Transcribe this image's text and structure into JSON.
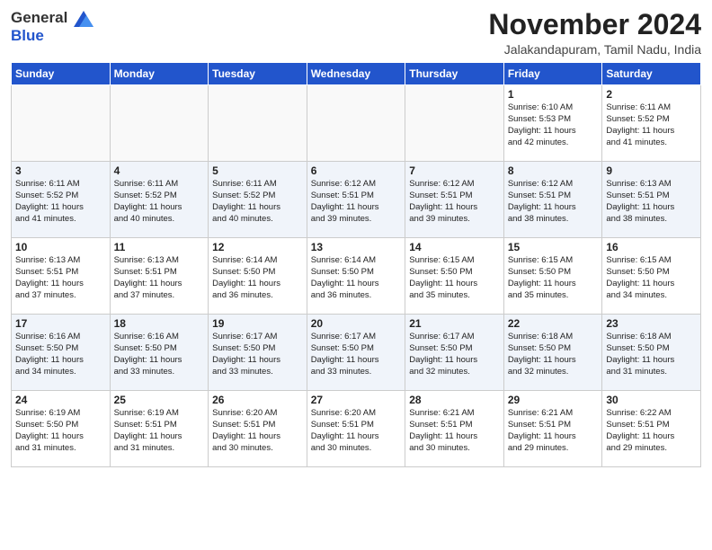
{
  "header": {
    "logo_line1": "General",
    "logo_line2": "Blue",
    "month_title": "November 2024",
    "subtitle": "Jalakandapuram, Tamil Nadu, India"
  },
  "weekdays": [
    "Sunday",
    "Monday",
    "Tuesday",
    "Wednesday",
    "Thursday",
    "Friday",
    "Saturday"
  ],
  "weeks": [
    [
      {
        "day": "",
        "info": ""
      },
      {
        "day": "",
        "info": ""
      },
      {
        "day": "",
        "info": ""
      },
      {
        "day": "",
        "info": ""
      },
      {
        "day": "",
        "info": ""
      },
      {
        "day": "1",
        "info": "Sunrise: 6:10 AM\nSunset: 5:53 PM\nDaylight: 11 hours\nand 42 minutes."
      },
      {
        "day": "2",
        "info": "Sunrise: 6:11 AM\nSunset: 5:52 PM\nDaylight: 11 hours\nand 41 minutes."
      }
    ],
    [
      {
        "day": "3",
        "info": "Sunrise: 6:11 AM\nSunset: 5:52 PM\nDaylight: 11 hours\nand 41 minutes."
      },
      {
        "day": "4",
        "info": "Sunrise: 6:11 AM\nSunset: 5:52 PM\nDaylight: 11 hours\nand 40 minutes."
      },
      {
        "day": "5",
        "info": "Sunrise: 6:11 AM\nSunset: 5:52 PM\nDaylight: 11 hours\nand 40 minutes."
      },
      {
        "day": "6",
        "info": "Sunrise: 6:12 AM\nSunset: 5:51 PM\nDaylight: 11 hours\nand 39 minutes."
      },
      {
        "day": "7",
        "info": "Sunrise: 6:12 AM\nSunset: 5:51 PM\nDaylight: 11 hours\nand 39 minutes."
      },
      {
        "day": "8",
        "info": "Sunrise: 6:12 AM\nSunset: 5:51 PM\nDaylight: 11 hours\nand 38 minutes."
      },
      {
        "day": "9",
        "info": "Sunrise: 6:13 AM\nSunset: 5:51 PM\nDaylight: 11 hours\nand 38 minutes."
      }
    ],
    [
      {
        "day": "10",
        "info": "Sunrise: 6:13 AM\nSunset: 5:51 PM\nDaylight: 11 hours\nand 37 minutes."
      },
      {
        "day": "11",
        "info": "Sunrise: 6:13 AM\nSunset: 5:51 PM\nDaylight: 11 hours\nand 37 minutes."
      },
      {
        "day": "12",
        "info": "Sunrise: 6:14 AM\nSunset: 5:50 PM\nDaylight: 11 hours\nand 36 minutes."
      },
      {
        "day": "13",
        "info": "Sunrise: 6:14 AM\nSunset: 5:50 PM\nDaylight: 11 hours\nand 36 minutes."
      },
      {
        "day": "14",
        "info": "Sunrise: 6:15 AM\nSunset: 5:50 PM\nDaylight: 11 hours\nand 35 minutes."
      },
      {
        "day": "15",
        "info": "Sunrise: 6:15 AM\nSunset: 5:50 PM\nDaylight: 11 hours\nand 35 minutes."
      },
      {
        "day": "16",
        "info": "Sunrise: 6:15 AM\nSunset: 5:50 PM\nDaylight: 11 hours\nand 34 minutes."
      }
    ],
    [
      {
        "day": "17",
        "info": "Sunrise: 6:16 AM\nSunset: 5:50 PM\nDaylight: 11 hours\nand 34 minutes."
      },
      {
        "day": "18",
        "info": "Sunrise: 6:16 AM\nSunset: 5:50 PM\nDaylight: 11 hours\nand 33 minutes."
      },
      {
        "day": "19",
        "info": "Sunrise: 6:17 AM\nSunset: 5:50 PM\nDaylight: 11 hours\nand 33 minutes."
      },
      {
        "day": "20",
        "info": "Sunrise: 6:17 AM\nSunset: 5:50 PM\nDaylight: 11 hours\nand 33 minutes."
      },
      {
        "day": "21",
        "info": "Sunrise: 6:17 AM\nSunset: 5:50 PM\nDaylight: 11 hours\nand 32 minutes."
      },
      {
        "day": "22",
        "info": "Sunrise: 6:18 AM\nSunset: 5:50 PM\nDaylight: 11 hours\nand 32 minutes."
      },
      {
        "day": "23",
        "info": "Sunrise: 6:18 AM\nSunset: 5:50 PM\nDaylight: 11 hours\nand 31 minutes."
      }
    ],
    [
      {
        "day": "24",
        "info": "Sunrise: 6:19 AM\nSunset: 5:50 PM\nDaylight: 11 hours\nand 31 minutes."
      },
      {
        "day": "25",
        "info": "Sunrise: 6:19 AM\nSunset: 5:51 PM\nDaylight: 11 hours\nand 31 minutes."
      },
      {
        "day": "26",
        "info": "Sunrise: 6:20 AM\nSunset: 5:51 PM\nDaylight: 11 hours\nand 30 minutes."
      },
      {
        "day": "27",
        "info": "Sunrise: 6:20 AM\nSunset: 5:51 PM\nDaylight: 11 hours\nand 30 minutes."
      },
      {
        "day": "28",
        "info": "Sunrise: 6:21 AM\nSunset: 5:51 PM\nDaylight: 11 hours\nand 30 minutes."
      },
      {
        "day": "29",
        "info": "Sunrise: 6:21 AM\nSunset: 5:51 PM\nDaylight: 11 hours\nand 29 minutes."
      },
      {
        "day": "30",
        "info": "Sunrise: 6:22 AM\nSunset: 5:51 PM\nDaylight: 11 hours\nand 29 minutes."
      }
    ]
  ]
}
